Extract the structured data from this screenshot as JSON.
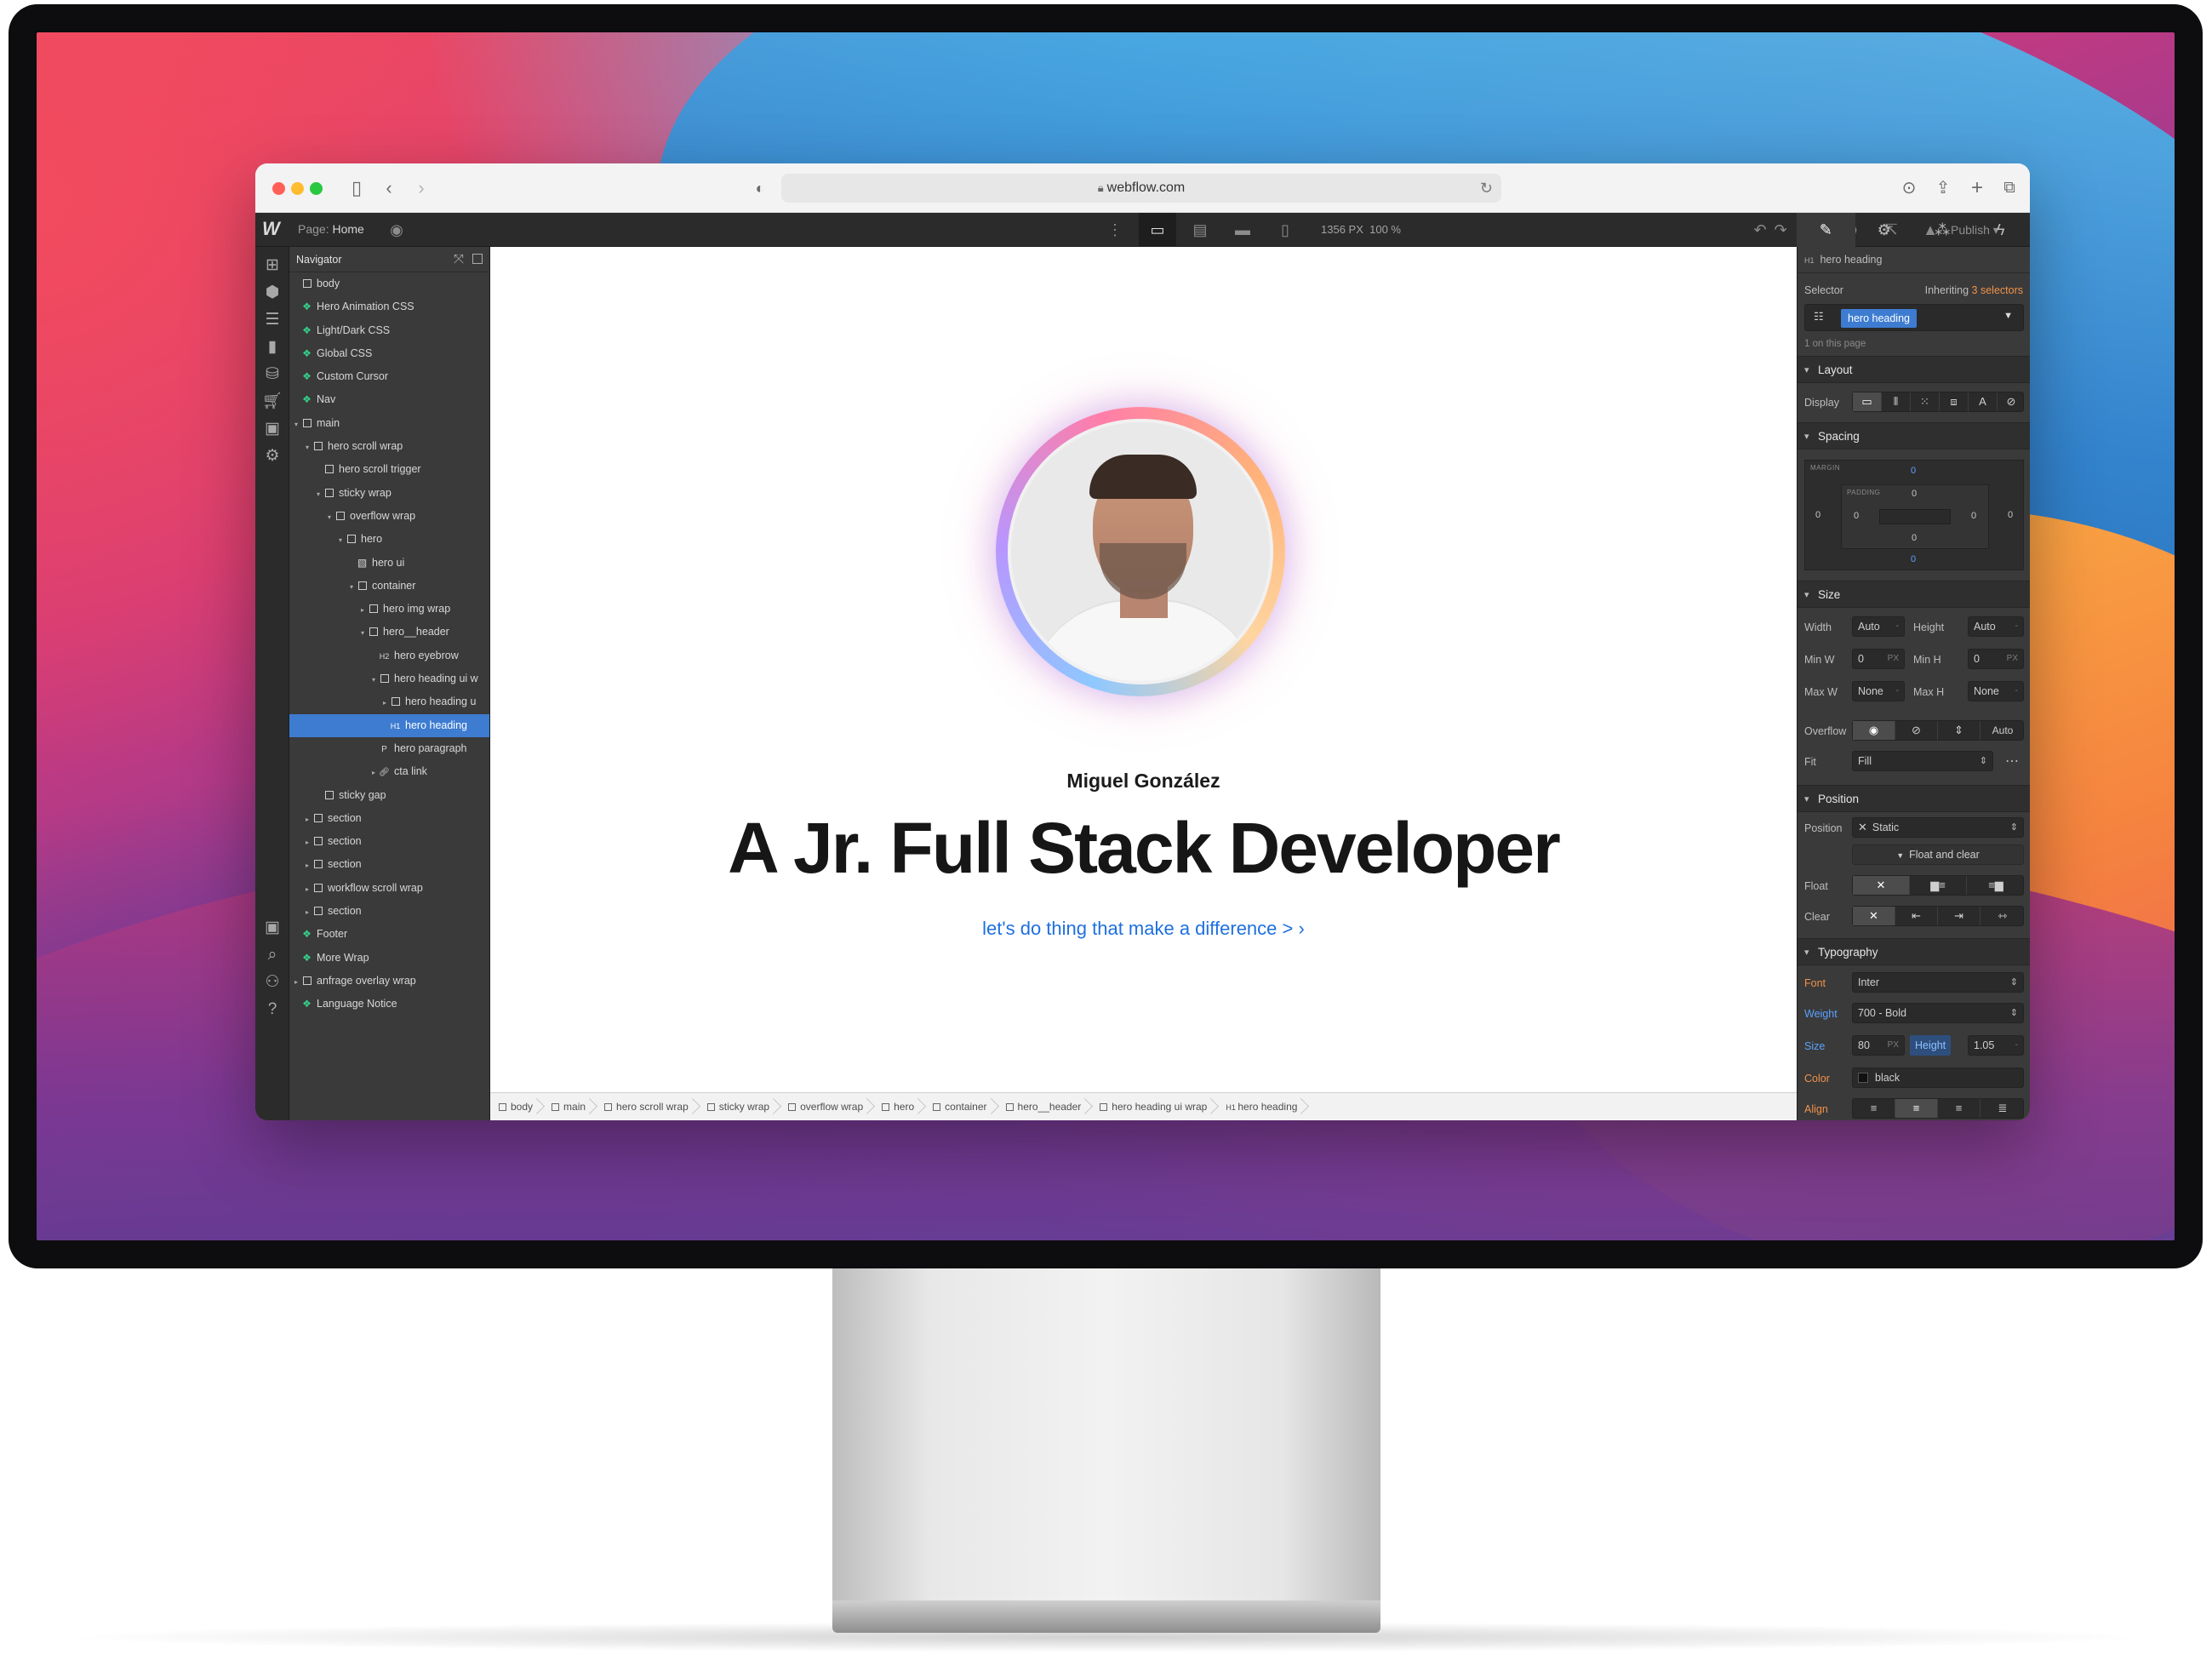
{
  "browser": {
    "url": "webflow.com"
  },
  "designer": {
    "page_label": "Page:",
    "page_name": "Home",
    "canvas_width": "1356 PX",
    "zoom": "100 %",
    "publish_label": "Publish"
  },
  "navigator": {
    "title": "Navigator",
    "items": [
      {
        "label": "body",
        "indent": 0,
        "kind": "box",
        "caret": ""
      },
      {
        "label": "Hero Animation CSS",
        "indent": 0,
        "kind": "component",
        "caret": ""
      },
      {
        "label": "Light/Dark CSS",
        "indent": 0,
        "kind": "component",
        "caret": ""
      },
      {
        "label": "Global CSS",
        "indent": 0,
        "kind": "component",
        "caret": ""
      },
      {
        "label": "Custom Cursor",
        "indent": 0,
        "kind": "component",
        "caret": ""
      },
      {
        "label": "Nav",
        "indent": 0,
        "kind": "component",
        "caret": ""
      },
      {
        "label": "main",
        "indent": 0,
        "kind": "box",
        "caret": "▾"
      },
      {
        "label": "hero scroll wrap",
        "indent": 1,
        "kind": "box",
        "caret": "▾"
      },
      {
        "label": "hero scroll trigger",
        "indent": 2,
        "kind": "box",
        "caret": ""
      },
      {
        "label": "sticky wrap",
        "indent": 2,
        "kind": "box",
        "caret": "▾"
      },
      {
        "label": "overflow wrap",
        "indent": 3,
        "kind": "box",
        "caret": "▾"
      },
      {
        "label": "hero",
        "indent": 4,
        "kind": "box",
        "caret": "▾"
      },
      {
        "label": "hero ui",
        "indent": 5,
        "kind": "embed",
        "caret": ""
      },
      {
        "label": "container",
        "indent": 5,
        "kind": "box",
        "caret": "▾"
      },
      {
        "label": "hero img wrap",
        "indent": 6,
        "kind": "box",
        "caret": "▸"
      },
      {
        "label": "hero__header",
        "indent": 6,
        "kind": "box",
        "caret": "▾"
      },
      {
        "label": "hero eyebrow",
        "indent": 7,
        "kind": "h2",
        "caret": ""
      },
      {
        "label": "hero heading ui w",
        "indent": 7,
        "kind": "box",
        "caret": "▾"
      },
      {
        "label": "hero heading u",
        "indent": 8,
        "kind": "box",
        "caret": "▸"
      },
      {
        "label": "hero heading",
        "indent": 8,
        "kind": "h1",
        "caret": "",
        "selected": true
      },
      {
        "label": "hero paragraph",
        "indent": 7,
        "kind": "p",
        "caret": ""
      },
      {
        "label": "cta link",
        "indent": 7,
        "kind": "link",
        "caret": "▸"
      },
      {
        "label": "sticky gap",
        "indent": 2,
        "kind": "box",
        "caret": ""
      },
      {
        "label": "section",
        "indent": 1,
        "kind": "box",
        "caret": "▸"
      },
      {
        "label": "section",
        "indent": 1,
        "kind": "box",
        "caret": "▸"
      },
      {
        "label": "section",
        "indent": 1,
        "kind": "box",
        "caret": "▸"
      },
      {
        "label": "workflow scroll wrap",
        "indent": 1,
        "kind": "box",
        "caret": "▸"
      },
      {
        "label": "section",
        "indent": 1,
        "kind": "box",
        "caret": "▸"
      },
      {
        "label": "Footer",
        "indent": 0,
        "kind": "component",
        "caret": ""
      },
      {
        "label": "More Wrap",
        "indent": 0,
        "kind": "component",
        "caret": ""
      },
      {
        "label": "anfrage overlay wrap",
        "indent": 0,
        "kind": "box",
        "caret": "▸"
      },
      {
        "label": "Language Notice",
        "indent": 0,
        "kind": "component",
        "caret": ""
      }
    ]
  },
  "canvas": {
    "eyebrow": "Miguel González",
    "heading": "A Jr. Full Stack Developer",
    "link": "let's do thing that make a difference > ›"
  },
  "breadcrumb": [
    "body",
    "main",
    "hero scroll wrap",
    "sticky wrap",
    "overflow wrap",
    "hero",
    "container",
    "hero__header",
    "hero heading ui wrap",
    "hero heading"
  ],
  "style_panel": {
    "element_name": "hero heading",
    "selector_label": "Selector",
    "inheriting_label": "Inheriting",
    "inheriting_count": "3 selectors",
    "selector_tag": "hero heading",
    "on_page": "1 on this page",
    "layout": {
      "title": "Layout",
      "display_label": "Display"
    },
    "spacing": {
      "title": "Spacing",
      "margin_label": "MARGIN",
      "padding_label": "PADDING",
      "margin_top": "0",
      "margin_right": "0",
      "margin_bottom": "0",
      "margin_left": "0",
      "padding_top": "0",
      "padding_right": "0",
      "padding_bottom": "0",
      "padding_left": "0"
    },
    "size": {
      "title": "Size",
      "width_label": "Width",
      "width": "Auto",
      "height_label": "Height",
      "height": "Auto",
      "minw_label": "Min W",
      "minw": "0",
      "minh_label": "Min H",
      "minh": "0",
      "maxw_label": "Max W",
      "maxw": "None",
      "maxh_label": "Max H",
      "maxh": "None",
      "unit": "PX",
      "unit_dash": "-",
      "overflow_label": "Overflow",
      "overflow_auto": "Auto",
      "fit_label": "Fit",
      "fit": "Fill"
    },
    "position": {
      "title": "Position",
      "position_label": "Position",
      "position": "Static",
      "float_clear": "Float and clear",
      "float_label": "Float",
      "clear_label": "Clear"
    },
    "typography": {
      "title": "Typography",
      "font_label": "Font",
      "font": "Inter",
      "weight_label": "Weight",
      "weight": "700 - Bold",
      "size_label": "Size",
      "size": "80",
      "size_unit": "PX",
      "line_height_label": "Height",
      "line_height": "1.05",
      "lh_unit": "-",
      "color_label": "Color",
      "color": "black",
      "align_label": "Align"
    }
  },
  "colors": {
    "selected": "#3d7cd1",
    "component": "#35d08a",
    "link": "#1f6fe0",
    "override": "#f1924a"
  }
}
